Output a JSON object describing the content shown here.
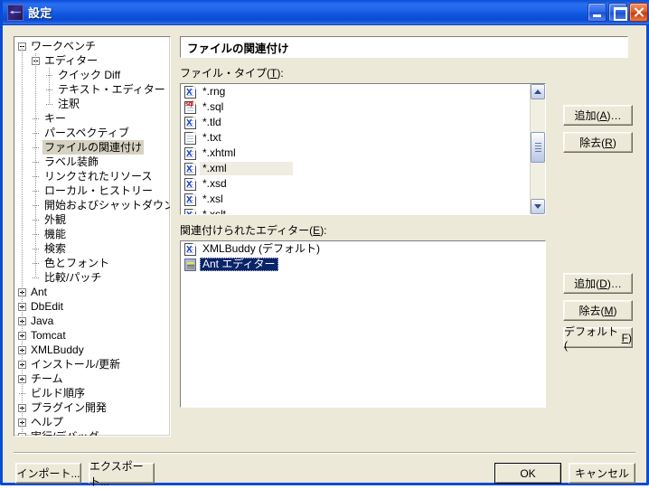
{
  "window": {
    "title": "設定",
    "icon": "eclipse-icon",
    "controls": {
      "minimize": "minimize-icon",
      "maximize": "maximize-icon",
      "close": "close-icon"
    }
  },
  "colors": {
    "titlebar_blue": "#0a4bd3",
    "dialog_face": "#ece9d8",
    "list_selection_blue": "#0a246a",
    "tree_selection_gray": "#d6d2c2",
    "filetype_selection": "#efece1"
  },
  "tree": {
    "items": [
      {
        "label": "ワークベンチ",
        "depth": 0,
        "toggle": "minus"
      },
      {
        "label": "エディター",
        "depth": 1,
        "toggle": "minus"
      },
      {
        "label": "クイック Diff",
        "depth": 2,
        "toggle": "dash"
      },
      {
        "label": "テキスト・エディター",
        "depth": 2,
        "toggle": "dash"
      },
      {
        "label": "注釈",
        "depth": 2,
        "toggle": "dash"
      },
      {
        "label": "キー",
        "depth": 1,
        "toggle": "dash"
      },
      {
        "label": "パースペクティブ",
        "depth": 1,
        "toggle": "dash"
      },
      {
        "label": "ファイルの関連付け",
        "depth": 1,
        "toggle": "dash",
        "selected": true
      },
      {
        "label": "ラベル装飾",
        "depth": 1,
        "toggle": "dash"
      },
      {
        "label": "リンクされたリソース",
        "depth": 1,
        "toggle": "dash"
      },
      {
        "label": "ローカル・ヒストリー",
        "depth": 1,
        "toggle": "dash"
      },
      {
        "label": "開始およびシャットダウン",
        "depth": 1,
        "toggle": "dash"
      },
      {
        "label": "外観",
        "depth": 1,
        "toggle": "dash"
      },
      {
        "label": "機能",
        "depth": 1,
        "toggle": "dash"
      },
      {
        "label": "検索",
        "depth": 1,
        "toggle": "dash"
      },
      {
        "label": "色とフォント",
        "depth": 1,
        "toggle": "dash"
      },
      {
        "label": "比較/パッチ",
        "depth": 1,
        "toggle": "dash"
      },
      {
        "label": "Ant",
        "depth": 0,
        "toggle": "plus"
      },
      {
        "label": "DbEdit",
        "depth": 0,
        "toggle": "plus"
      },
      {
        "label": "Java",
        "depth": 0,
        "toggle": "plus"
      },
      {
        "label": "Tomcat",
        "depth": 0,
        "toggle": "plus"
      },
      {
        "label": "XMLBuddy",
        "depth": 0,
        "toggle": "plus"
      },
      {
        "label": "インストール/更新",
        "depth": 0,
        "toggle": "plus"
      },
      {
        "label": "チーム",
        "depth": 0,
        "toggle": "plus"
      },
      {
        "label": "ビルド順序",
        "depth": 0,
        "toggle": "dash"
      },
      {
        "label": "プラグイン開発",
        "depth": 0,
        "toggle": "plus"
      },
      {
        "label": "ヘルプ",
        "depth": 0,
        "toggle": "plus"
      },
      {
        "label": "実行/デバッグ",
        "depth": 0,
        "toggle": "plus"
      }
    ]
  },
  "page": {
    "title": "ファイルの関連付け",
    "filetypes_label_prefix": "ファイル・タイプ(",
    "filetypes_label_acc": "T",
    "filetypes_label_suffix": "):",
    "editors_label_prefix": "関連付けられたエディター(",
    "editors_label_acc": "E",
    "editors_label_suffix": "):"
  },
  "filetypes": {
    "items": [
      {
        "label": "*.rng",
        "icon": "xml-document-icon"
      },
      {
        "label": "*.sql",
        "icon": "sql-document-icon"
      },
      {
        "label": "*.tld",
        "icon": "xml-document-icon"
      },
      {
        "label": "*.txt",
        "icon": "text-document-icon"
      },
      {
        "label": "*.xhtml",
        "icon": "xml-document-icon"
      },
      {
        "label": "*.xml",
        "icon": "xml-document-icon",
        "selected": true
      },
      {
        "label": "*.xsd",
        "icon": "xml-document-icon"
      },
      {
        "label": "*.xsl",
        "icon": "xml-document-icon"
      },
      {
        "label": "*.xslt",
        "icon": "xml-document-icon"
      }
    ],
    "scrollbar": {
      "thumb_top_percent": 48
    }
  },
  "filetype_buttons": [
    {
      "label_prefix": "追加(",
      "acc": "A",
      "label_suffix": ")…",
      "name": "add-filetype-button"
    },
    {
      "label_prefix": "除去(",
      "acc": "R",
      "label_suffix": ")",
      "name": "remove-filetype-button"
    }
  ],
  "editors": {
    "items": [
      {
        "label": "XMLBuddy (デフォルト)",
        "icon": "xml-document-icon",
        "selected": false
      },
      {
        "label": "Ant エディター",
        "icon": "ant-editor-icon",
        "selected": true
      }
    ]
  },
  "editor_buttons": [
    {
      "label_prefix": "追加(",
      "acc": "D",
      "label_suffix": ")…",
      "name": "add-editor-button"
    },
    {
      "label_prefix": "除去(",
      "acc": "M",
      "label_suffix": ")",
      "name": "remove-editor-button"
    },
    {
      "label_prefix": "デフォルト(",
      "acc": "F",
      "label_suffix": ")",
      "name": "default-editor-button"
    }
  ],
  "footer": {
    "import": "インポート...",
    "export": "エクスポート...",
    "ok": "OK",
    "cancel": "キャンセル"
  }
}
